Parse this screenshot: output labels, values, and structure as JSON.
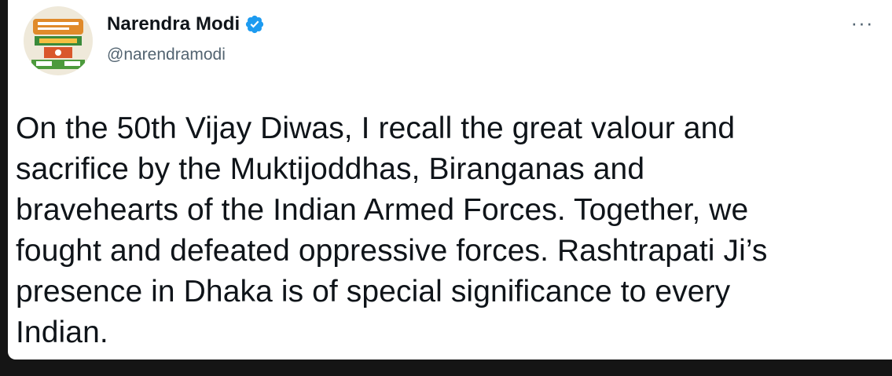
{
  "author": {
    "display_name": "Narendra Modi",
    "handle": "@narendramodi",
    "verified_icon": "verified-badge-icon",
    "avatar_icon": "profile-avatar"
  },
  "menu": {
    "more_label": "···",
    "more_icon": "more-options-icon"
  },
  "tweet": {
    "text": "On the 50th Vijay Diwas, I recall the great valour and\nsacrifice by the Muktijoddhas, Biranganas and\nbravehearts of the Indian Armed Forces. Together, we\nfought and defeated oppressive forces. Rashtrapati Ji’s\npresence in Dhaka is of special significance to every\nIndian."
  },
  "colors": {
    "verified_blue": "#1d9bf0",
    "text_primary": "#0f1419",
    "text_secondary": "#536471",
    "background_dark": "#151515"
  }
}
